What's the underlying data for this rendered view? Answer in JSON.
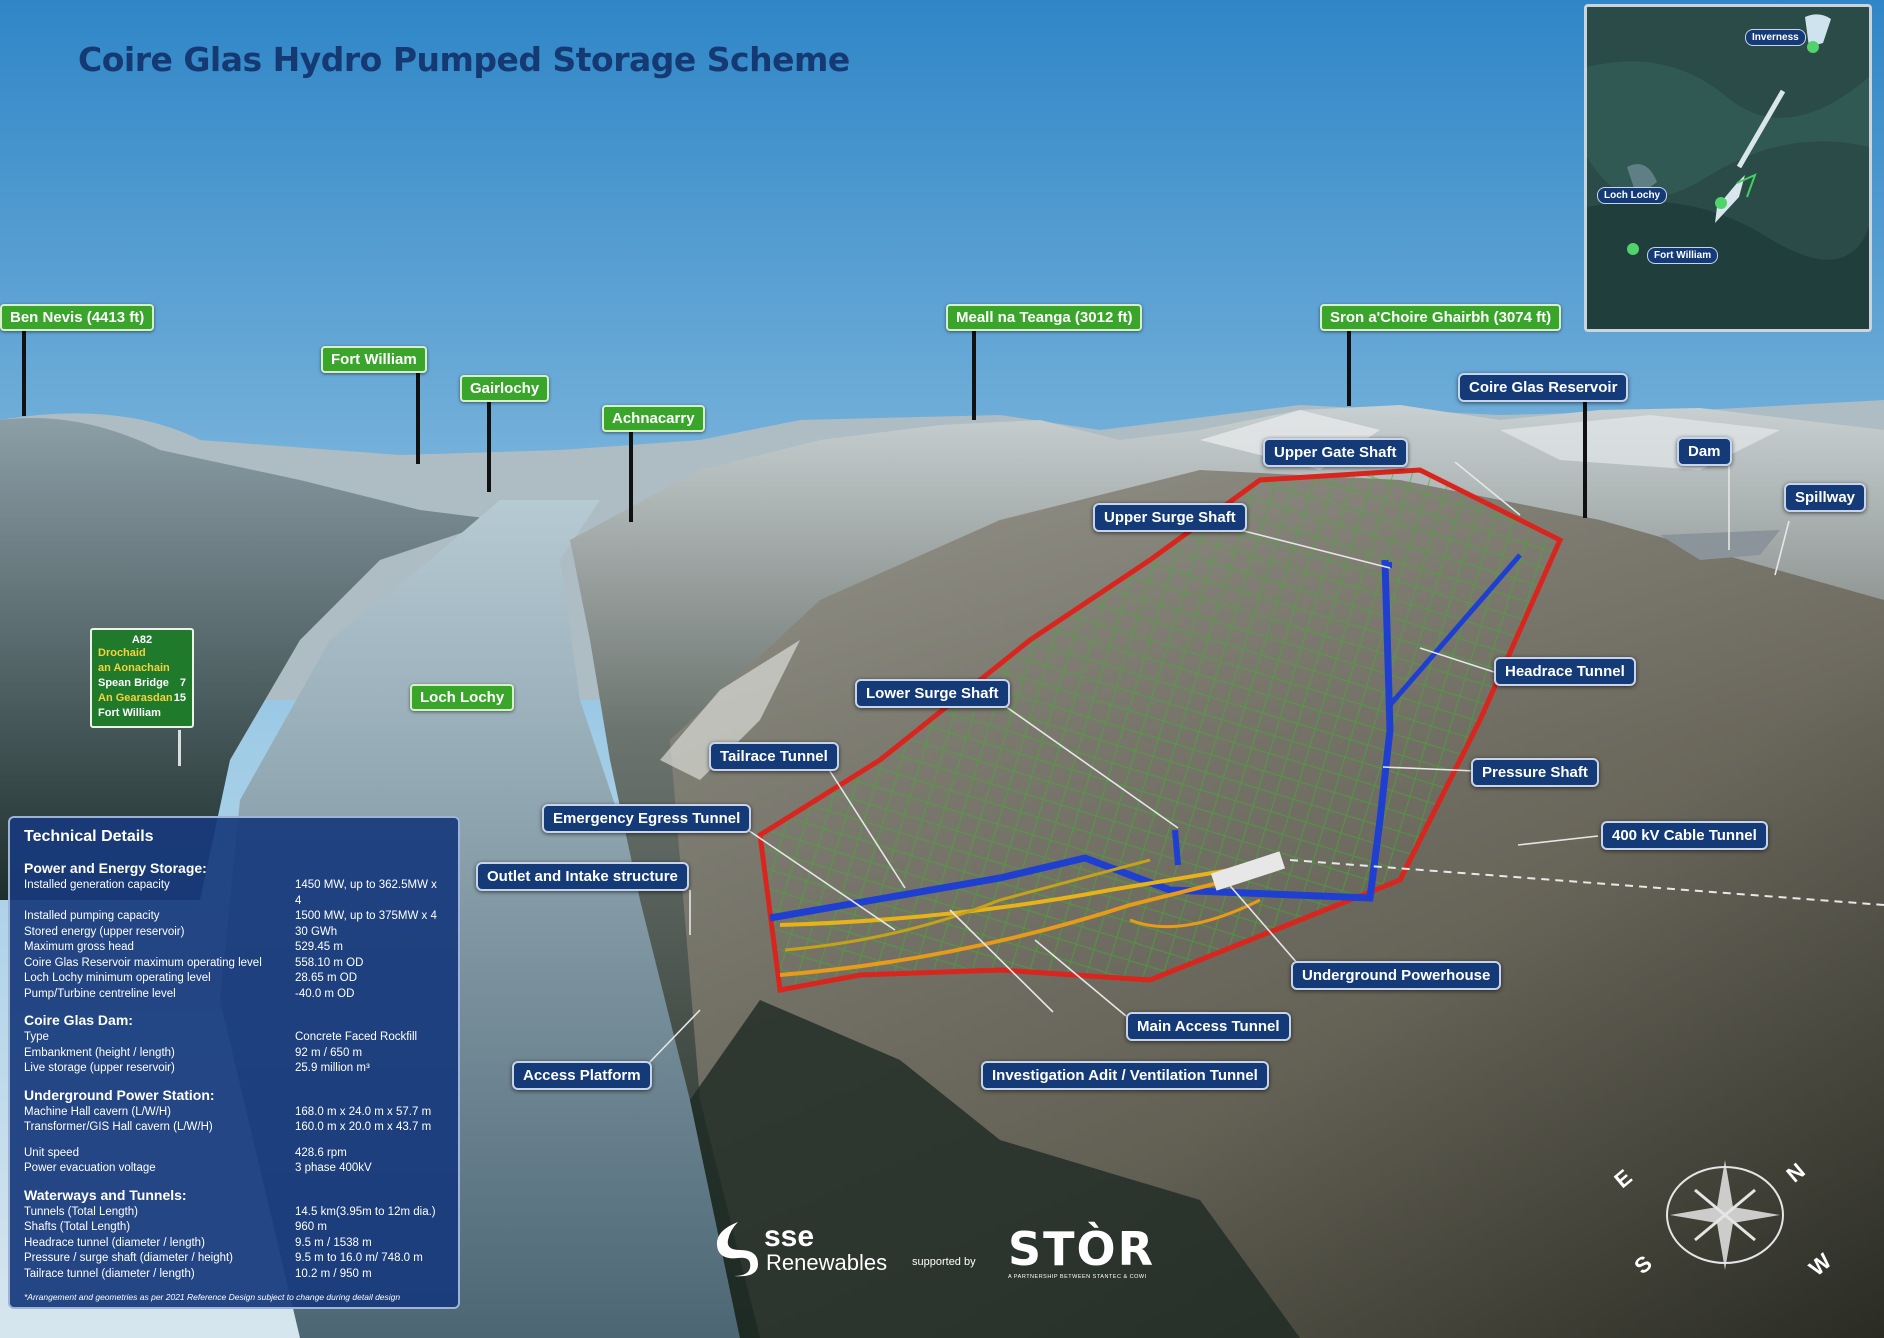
{
  "title": "Coire Glas Hydro Pumped Storage Scheme",
  "colors": {
    "label_green": "#3aa52b",
    "label_blue": "#143b78",
    "outline_red": "#d8261e",
    "tunnel_blue": "#1f3fd1",
    "tunnel_yellow": "#e8b21a",
    "grid_green": "#3fae2e"
  },
  "place_labels": {
    "ben_nevis": "Ben Nevis (4413 ft)",
    "fort_william": "Fort William",
    "gairlochy": "Gairlochy",
    "achnacarry": "Achnacarry",
    "meall_na_teanga": "Meall na Teanga (3012 ft)",
    "sron": "Sron a'Choire Ghairbh (3074 ft)",
    "loch_lochy": "Loch Lochy"
  },
  "feature_labels": {
    "coire_glas_reservoir": "Coire Glas Reservoir",
    "upper_gate_shaft": "Upper Gate Shaft",
    "dam": "Dam",
    "spillway": "Spillway",
    "upper_surge_shaft": "Upper Surge Shaft",
    "headrace_tunnel": "Headrace Tunnel",
    "lower_surge_shaft": "Lower Surge Shaft",
    "pressure_shaft": "Pressure Shaft",
    "tailrace_tunnel": "Tailrace Tunnel",
    "cable_tunnel": "400 kV Cable Tunnel",
    "emergency_egress_tunnel": "Emergency Egress Tunnel",
    "outlet_intake": "Outlet and Intake structure",
    "underground_powerhouse": "Underground Powerhouse",
    "main_access_tunnel": "Main Access Tunnel",
    "access_platform": "Access Platform",
    "investigation_adit": "Investigation Adit / Ventilation Tunnel"
  },
  "inset_map": {
    "inverness": "Inverness",
    "loch_lochy": "Loch Lochy",
    "fort_william": "Fort William"
  },
  "road_sign": {
    "road": "A82",
    "line1": "Drochaid",
    "line2": "an Aonachain",
    "line3": "Spean Bridge",
    "line3_dist": "7",
    "line4": "An Gearasdan",
    "line4_dist": "15",
    "line5": "Fort William"
  },
  "technical": {
    "heading": "Technical Details",
    "sections": [
      {
        "title": "Power and Energy Storage:",
        "rows": [
          [
            "Installed generation capacity",
            "1450 MW, up to 362.5MW x 4"
          ],
          [
            "Installed pumping capacity",
            "1500 MW, up to 375MW x 4"
          ],
          [
            "Stored energy (upper reservoir)",
            "30 GWh"
          ],
          [
            "Maximum gross head",
            "529.45 m"
          ],
          [
            "Coire Glas Reservoir maximum operating level",
            "558.10 m OD"
          ],
          [
            "Loch Lochy minimum operating level",
            "28.65 m OD"
          ],
          [
            "Pump/Turbine centreline level",
            "-40.0 m OD"
          ]
        ]
      },
      {
        "title": "Coire Glas Dam:",
        "rows": [
          [
            "Type",
            "Concrete Faced Rockfill"
          ],
          [
            "Embankment (height / length)",
            "92 m / 650 m"
          ],
          [
            "Live storage (upper reservoir)",
            "25.9 million m³"
          ]
        ]
      },
      {
        "title": "Underground Power Station:",
        "rows": [
          [
            "Machine Hall cavern (L/W/H)",
            "168.0 m x 24.0 m x 57.7 m"
          ],
          [
            "Transformer/GIS Hall cavern (L/W/H)",
            "160.0 m x 20.0 m x 43.7 m"
          ],
          [
            "",
            ""
          ],
          [
            "Unit speed",
            "428.6 rpm"
          ],
          [
            "Power evacuation voltage",
            "3 phase 400kV"
          ]
        ]
      },
      {
        "title": "Waterways and Tunnels:",
        "rows": [
          [
            "Tunnels (Total Length)",
            "14.5 km(3.95m to 12m dia.)"
          ],
          [
            "Shafts (Total Length)",
            "960 m"
          ],
          [
            "Headrace tunnel (diameter / length)",
            "9.5 m / 1538 m"
          ],
          [
            "Pressure / surge shaft (diameter / height)",
            "9.5 m to 16.0 m/ 748.0 m"
          ],
          [
            "Tailrace tunnel (diameter / length)",
            "10.2 m / 950 m"
          ]
        ]
      }
    ],
    "note": "*Arrangement and geometries as per 2021 Reference Design subject to change during detail design"
  },
  "logos": {
    "sse_top": "sse",
    "sse_bottom": "Renewables",
    "supported_by": "supported by",
    "stor": "STÒR",
    "stor_sub": "A PARTNERSHIP BETWEEN STANTEC & COWI"
  },
  "compass": {
    "n": "N",
    "e": "E",
    "s": "S",
    "w": "W"
  }
}
